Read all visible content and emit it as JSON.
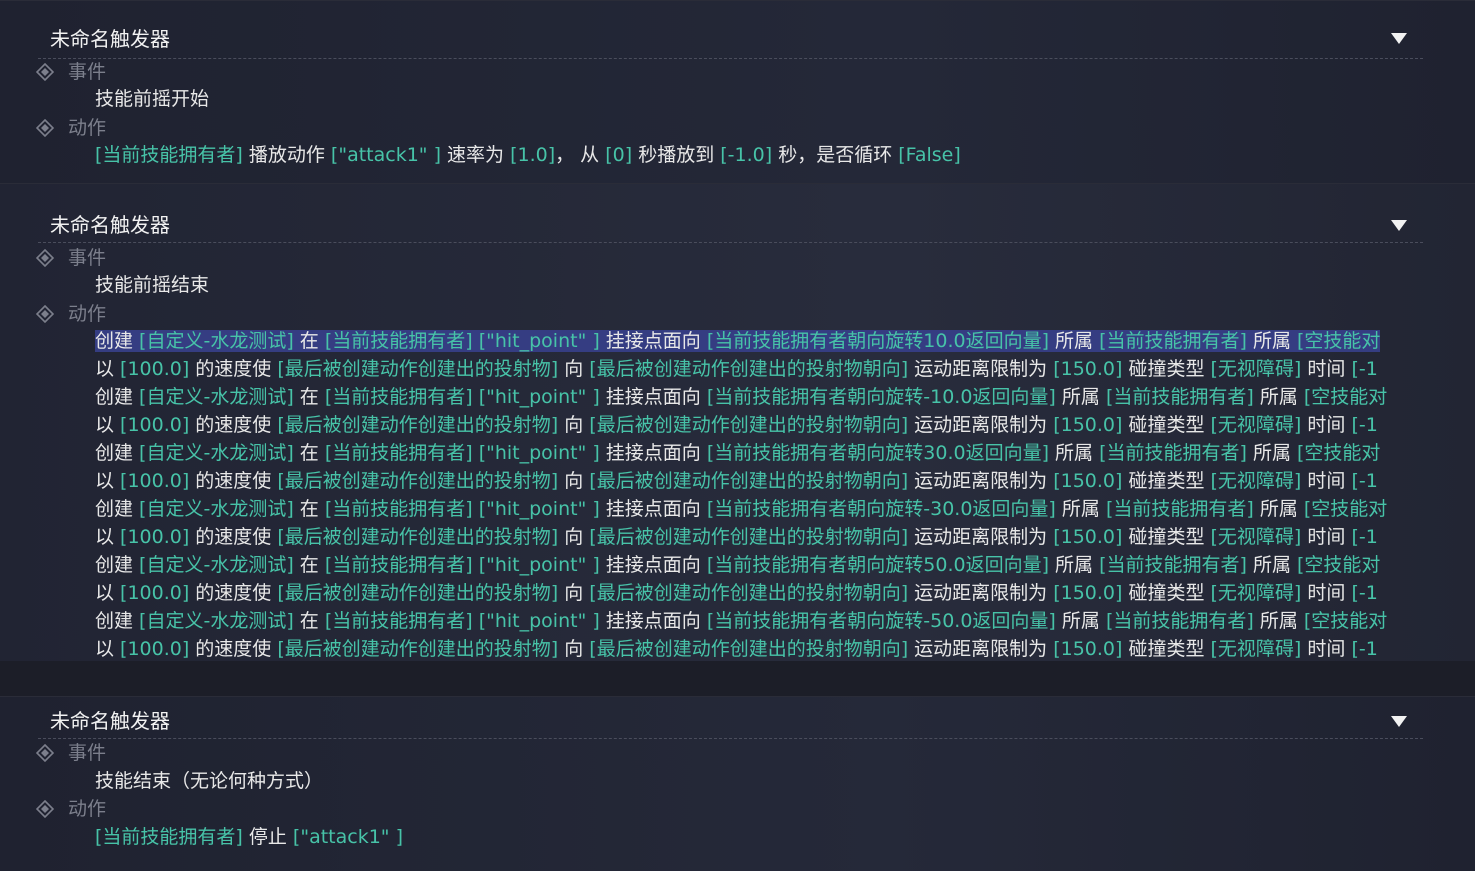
{
  "triggers": [
    {
      "title": "未命名触发器",
      "event_label": "事件",
      "event": "技能前摇开始",
      "action_label": "动作",
      "actions": [
        [
          [
            "ar",
            "[当前技能拥有者]"
          ],
          [
            "kw",
            " 播放动作 "
          ],
          [
            "ar",
            "[\"attack1\" ]"
          ],
          [
            "kw",
            " 速率为 "
          ],
          [
            "ar",
            "[1.0]"
          ],
          [
            "kw",
            "， 从 "
          ],
          [
            "ar",
            "[0]"
          ],
          [
            "kw",
            " 秒播放到 "
          ],
          [
            "ar",
            "[-1.0]"
          ],
          [
            "kw",
            " 秒，是否循环 "
          ],
          [
            "ar",
            "[False]"
          ]
        ]
      ]
    },
    {
      "title": "未命名触发器",
      "event_label": "事件",
      "event": "技能前摇结束",
      "action_label": "动作",
      "actions": [
        [
          [
            "kw",
            "创建 "
          ],
          [
            "ar",
            "[自定义-水龙测试]"
          ],
          [
            "kw",
            " 在 "
          ],
          [
            "ar",
            "[当前技能拥有者]"
          ],
          [
            "ar",
            " [\"hit_point\" ]"
          ],
          [
            "kw",
            " 挂接点面向 "
          ],
          [
            "ar",
            "[当前技能拥有者朝向旋转10.0返回向量]"
          ],
          [
            "kw",
            " 所属 "
          ],
          [
            "ar",
            "[当前技能拥有者]"
          ],
          [
            "kw",
            " 所属 "
          ],
          [
            "ar",
            "[空技能对"
          ]
        ],
        [
          [
            "kw",
            "以 "
          ],
          [
            "ar",
            "[100.0]"
          ],
          [
            "kw",
            " 的速度使 "
          ],
          [
            "ar",
            "[最后被创建动作创建出的投射物]"
          ],
          [
            "kw",
            " 向 "
          ],
          [
            "ar",
            "[最后被创建动作创建出的投射物朝向]"
          ],
          [
            "kw",
            " 运动距离限制为 "
          ],
          [
            "ar",
            "[150.0]"
          ],
          [
            "kw",
            " 碰撞类型 "
          ],
          [
            "ar",
            "[无视障碍]"
          ],
          [
            "kw",
            " 时间 "
          ],
          [
            "ar",
            "[-1"
          ]
        ],
        [
          [
            "kw",
            "创建 "
          ],
          [
            "ar",
            "[自定义-水龙测试]"
          ],
          [
            "kw",
            " 在 "
          ],
          [
            "ar",
            "[当前技能拥有者]"
          ],
          [
            "ar",
            " [\"hit_point\" ]"
          ],
          [
            "kw",
            " 挂接点面向 "
          ],
          [
            "ar",
            "[当前技能拥有者朝向旋转-10.0返回向量]"
          ],
          [
            "kw",
            " 所属 "
          ],
          [
            "ar",
            "[当前技能拥有者]"
          ],
          [
            "kw",
            " 所属 "
          ],
          [
            "ar",
            "[空技能对"
          ]
        ],
        [
          [
            "kw",
            "以 "
          ],
          [
            "ar",
            "[100.0]"
          ],
          [
            "kw",
            " 的速度使 "
          ],
          [
            "ar",
            "[最后被创建动作创建出的投射物]"
          ],
          [
            "kw",
            " 向 "
          ],
          [
            "ar",
            "[最后被创建动作创建出的投射物朝向]"
          ],
          [
            "kw",
            " 运动距离限制为 "
          ],
          [
            "ar",
            "[150.0]"
          ],
          [
            "kw",
            " 碰撞类型 "
          ],
          [
            "ar",
            "[无视障碍]"
          ],
          [
            "kw",
            " 时间 "
          ],
          [
            "ar",
            "[-1"
          ]
        ],
        [
          [
            "kw",
            "创建 "
          ],
          [
            "ar",
            "[自定义-水龙测试]"
          ],
          [
            "kw",
            " 在 "
          ],
          [
            "ar",
            "[当前技能拥有者]"
          ],
          [
            "ar",
            " [\"hit_point\" ]"
          ],
          [
            "kw",
            " 挂接点面向 "
          ],
          [
            "ar",
            "[当前技能拥有者朝向旋转30.0返回向量]"
          ],
          [
            "kw",
            " 所属 "
          ],
          [
            "ar",
            "[当前技能拥有者]"
          ],
          [
            "kw",
            " 所属 "
          ],
          [
            "ar",
            "[空技能对"
          ]
        ],
        [
          [
            "kw",
            "以 "
          ],
          [
            "ar",
            "[100.0]"
          ],
          [
            "kw",
            " 的速度使 "
          ],
          [
            "ar",
            "[最后被创建动作创建出的投射物]"
          ],
          [
            "kw",
            " 向 "
          ],
          [
            "ar",
            "[最后被创建动作创建出的投射物朝向]"
          ],
          [
            "kw",
            " 运动距离限制为 "
          ],
          [
            "ar",
            "[150.0]"
          ],
          [
            "kw",
            " 碰撞类型 "
          ],
          [
            "ar",
            "[无视障碍]"
          ],
          [
            "kw",
            " 时间 "
          ],
          [
            "ar",
            "[-1"
          ]
        ],
        [
          [
            "kw",
            "创建 "
          ],
          [
            "ar",
            "[自定义-水龙测试]"
          ],
          [
            "kw",
            " 在 "
          ],
          [
            "ar",
            "[当前技能拥有者]"
          ],
          [
            "ar",
            " [\"hit_point\" ]"
          ],
          [
            "kw",
            " 挂接点面向 "
          ],
          [
            "ar",
            "[当前技能拥有者朝向旋转-30.0返回向量]"
          ],
          [
            "kw",
            " 所属 "
          ],
          [
            "ar",
            "[当前技能拥有者]"
          ],
          [
            "kw",
            " 所属 "
          ],
          [
            "ar",
            "[空技能对"
          ]
        ],
        [
          [
            "kw",
            "以 "
          ],
          [
            "ar",
            "[100.0]"
          ],
          [
            "kw",
            " 的速度使 "
          ],
          [
            "ar",
            "[最后被创建动作创建出的投射物]"
          ],
          [
            "kw",
            " 向 "
          ],
          [
            "ar",
            "[最后被创建动作创建出的投射物朝向]"
          ],
          [
            "kw",
            " 运动距离限制为 "
          ],
          [
            "ar",
            "[150.0]"
          ],
          [
            "kw",
            " 碰撞类型 "
          ],
          [
            "ar",
            "[无视障碍]"
          ],
          [
            "kw",
            " 时间 "
          ],
          [
            "ar",
            "[-1"
          ]
        ],
        [
          [
            "kw",
            "创建 "
          ],
          [
            "ar",
            "[自定义-水龙测试]"
          ],
          [
            "kw",
            " 在 "
          ],
          [
            "ar",
            "[当前技能拥有者]"
          ],
          [
            "ar",
            " [\"hit_point\" ]"
          ],
          [
            "kw",
            " 挂接点面向 "
          ],
          [
            "ar",
            "[当前技能拥有者朝向旋转50.0返回向量]"
          ],
          [
            "kw",
            " 所属 "
          ],
          [
            "ar",
            "[当前技能拥有者]"
          ],
          [
            "kw",
            " 所属 "
          ],
          [
            "ar",
            "[空技能对"
          ]
        ],
        [
          [
            "kw",
            "以 "
          ],
          [
            "ar",
            "[100.0]"
          ],
          [
            "kw",
            " 的速度使 "
          ],
          [
            "ar",
            "[最后被创建动作创建出的投射物]"
          ],
          [
            "kw",
            " 向 "
          ],
          [
            "ar",
            "[最后被创建动作创建出的投射物朝向]"
          ],
          [
            "kw",
            " 运动距离限制为 "
          ],
          [
            "ar",
            "[150.0]"
          ],
          [
            "kw",
            " 碰撞类型 "
          ],
          [
            "ar",
            "[无视障碍]"
          ],
          [
            "kw",
            " 时间 "
          ],
          [
            "ar",
            "[-1"
          ]
        ],
        [
          [
            "kw",
            "创建 "
          ],
          [
            "ar",
            "[自定义-水龙测试]"
          ],
          [
            "kw",
            " 在 "
          ],
          [
            "ar",
            "[当前技能拥有者]"
          ],
          [
            "ar",
            " [\"hit_point\" ]"
          ],
          [
            "kw",
            " 挂接点面向 "
          ],
          [
            "ar",
            "[当前技能拥有者朝向旋转-50.0返回向量]"
          ],
          [
            "kw",
            " 所属 "
          ],
          [
            "ar",
            "[当前技能拥有者]"
          ],
          [
            "kw",
            " 所属 "
          ],
          [
            "ar",
            "[空技能对"
          ]
        ],
        [
          [
            "kw",
            "以 "
          ],
          [
            "ar",
            "[100.0]"
          ],
          [
            "kw",
            " 的速度使 "
          ],
          [
            "ar",
            "[最后被创建动作创建出的投射物]"
          ],
          [
            "kw",
            " 向 "
          ],
          [
            "ar",
            "[最后被创建动作创建出的投射物朝向]"
          ],
          [
            "kw",
            " 运动距离限制为 "
          ],
          [
            "ar",
            "[150.0]"
          ],
          [
            "kw",
            " 碰撞类型 "
          ],
          [
            "ar",
            "[无视障碍]"
          ],
          [
            "kw",
            " 时间 "
          ],
          [
            "ar",
            "[-1"
          ]
        ]
      ]
    },
    {
      "title": "未命名触发器",
      "event_label": "事件",
      "event": "技能结束（无论何种方式）",
      "action_label": "动作",
      "actions": [
        [
          [
            "ar",
            "[当前技能拥有者]"
          ],
          [
            "kw",
            " 停止 "
          ],
          [
            "ar",
            "[\"attack1\" ]"
          ]
        ]
      ]
    }
  ],
  "selected_action": {
    "trigger": 1,
    "line": 0
  },
  "colors": {
    "argument": "#47c3a8",
    "keyword": "#e8e8e8",
    "label": "#7c7f8c",
    "selection": "#353d82"
  },
  "icons": {
    "collapse": "chevron-down-icon",
    "section": "diamond-icon"
  }
}
